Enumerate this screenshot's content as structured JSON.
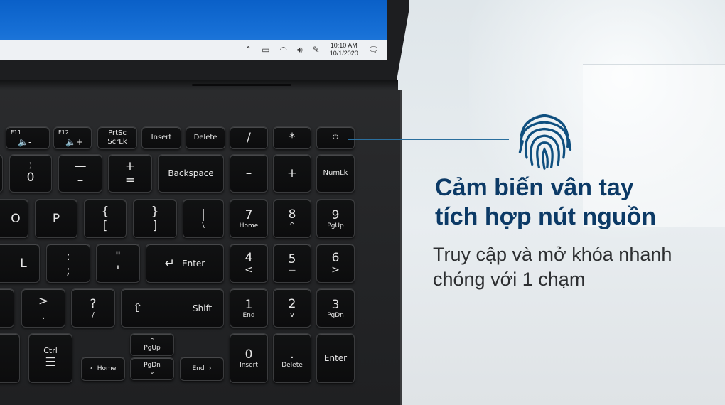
{
  "taskbar": {
    "time": "10:10 AM",
    "date": "10/1/2020"
  },
  "keys": {
    "f11": {
      "top": "F11",
      "icon": "🔈-"
    },
    "f12": {
      "top": "F12",
      "icon": "🔈+"
    },
    "prtsc": {
      "line1": "PrtSc",
      "line2": "ScrLk"
    },
    "insert": "Insert",
    "delete": "Delete",
    "slash": "/",
    "asterisk": "*",
    "power": "⏻",
    "zero": {
      "top": ")",
      "main": "0"
    },
    "minus": {
      "top": "—",
      "main": "–"
    },
    "plus": {
      "top": "+",
      "main": "="
    },
    "backspace": "Backspace",
    "np_minus": "–",
    "np_plus": "+",
    "numlk": "NumLk",
    "o": "O",
    "p": "P",
    "lbracket": {
      "top": "{",
      "main": "["
    },
    "rbracket": {
      "top": "}",
      "main": "]"
    },
    "pipe": {
      "top": "|",
      "main": "\\"
    },
    "np7": {
      "main": "7",
      "sub": "Home"
    },
    "np8": {
      "main": "8",
      "sub": "^"
    },
    "np9": {
      "main": "9",
      "sub": "PgUp"
    },
    "l": "L",
    "semicolon": {
      "top": ":",
      "main": ";"
    },
    "quote": {
      "top": "\"",
      "main": "'"
    },
    "enter": "Enter",
    "np4": {
      "main": "4",
      "sub": "<"
    },
    "np5": {
      "main": "5",
      "sub": "—"
    },
    "np6": {
      "main": "6",
      "sub": ">"
    },
    "period": {
      "top": ">",
      "main": "."
    },
    "question": {
      "top": "?",
      "main": "/"
    },
    "shift": "Shift",
    "np1": {
      "main": "1",
      "sub": "End"
    },
    "np2": {
      "main": "2",
      "sub": "v"
    },
    "np3": {
      "main": "3",
      "sub": "PgDn"
    },
    "ctrl": "Ctrl",
    "home": "Home",
    "pgup": "PgUp",
    "pgdn": "PgDn",
    "end": "End",
    "np0": {
      "main": "0",
      "sub": "Insert"
    },
    "npdot": {
      "main": ".",
      "sub": "Delete"
    },
    "np_enter": "Enter"
  },
  "callout": {
    "title_line1": "Cảm biến vân tay",
    "title_line2": "tích hợp nút nguồn",
    "subtitle_line1": "Truy cập và mở khóa nhanh",
    "subtitle_line2": "chóng với 1 chạm"
  },
  "colors": {
    "title": "#0c3a66",
    "subtitle": "#2d2f31",
    "fingerprint": "#0f4f7f",
    "screen": "#1770d6"
  },
  "icons": [
    "fingerprint-icon",
    "power-icon",
    "enter-arrow-icon",
    "shift-arrow-icon",
    "menu-icon"
  ]
}
